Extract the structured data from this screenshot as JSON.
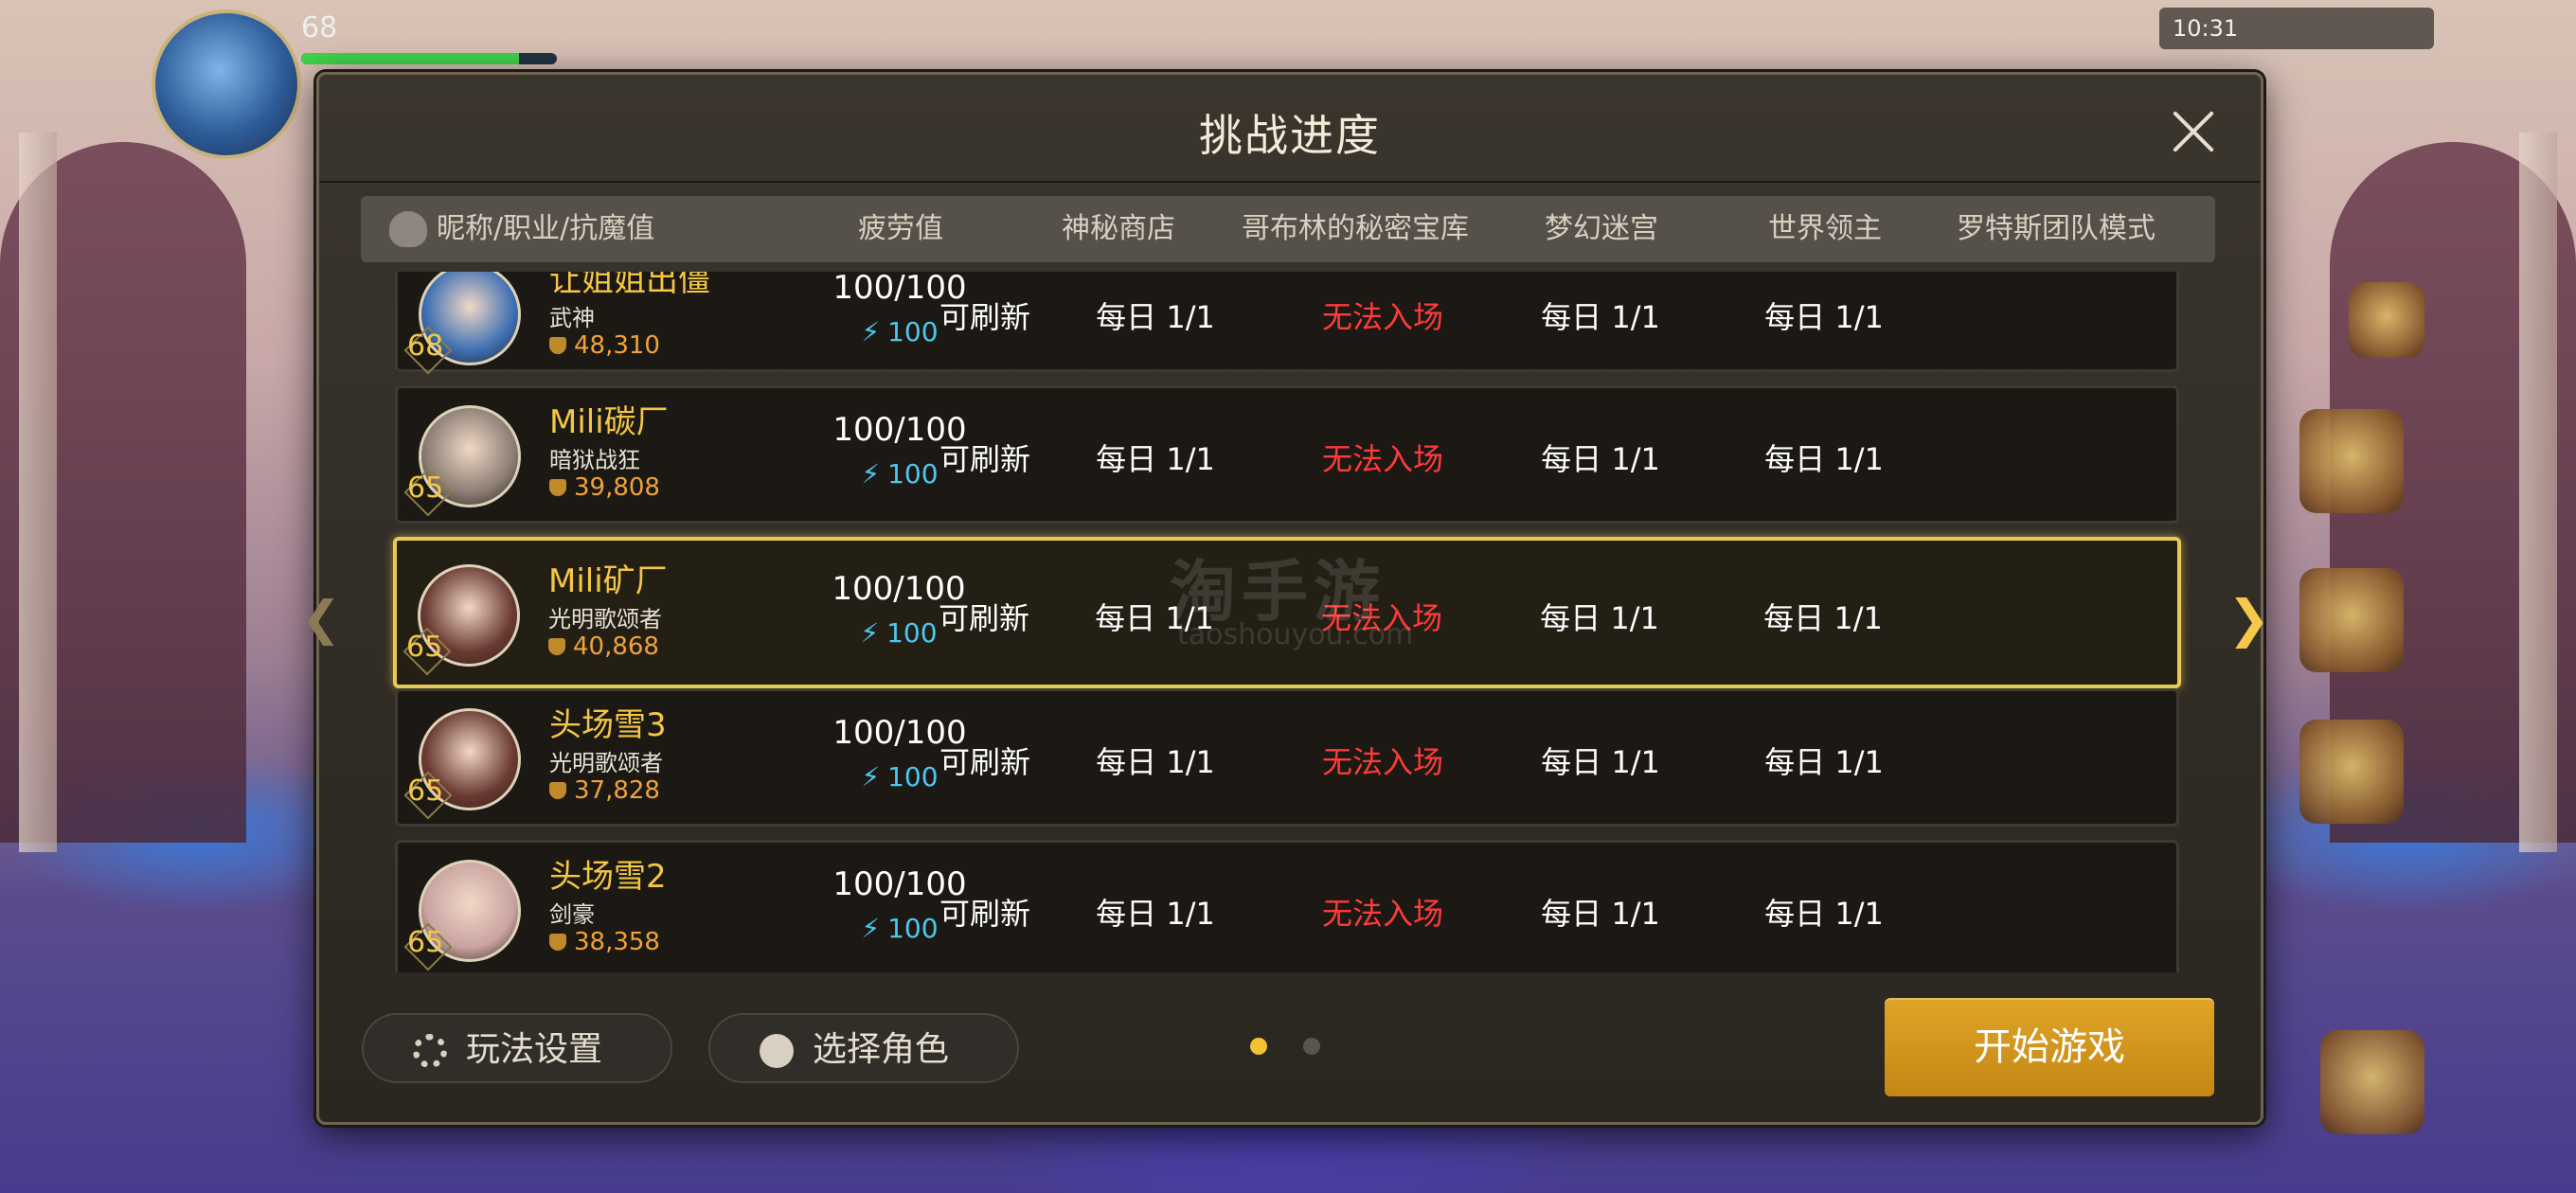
{
  "hud": {
    "level": "68",
    "exp_fraction": 0.85,
    "status_text": "10:31"
  },
  "dialog": {
    "title": "挑战进度",
    "columns": [
      "昵称/职业/抗魔值",
      "疲劳值",
      "神秘商店",
      "哥布林的秘密宝库",
      "梦幻迷宫",
      "世界领主",
      "罗特斯团队模式"
    ]
  },
  "rows": [
    {
      "name": "让姐姐出僵",
      "class": "武神",
      "level": "68",
      "score": "48,310",
      "fatigue": "100/100",
      "energy": "100",
      "shop": "可刷新",
      "goblin": "每日 1/1",
      "maze": "无法入场",
      "lord": "每日 1/1",
      "raid": "每日 1/1",
      "selected": false,
      "avatar_color": "#3d6fb3"
    },
    {
      "name": "Mili碳厂",
      "class": "暗狱战狂",
      "level": "65",
      "score": "39,808",
      "fatigue": "100/100",
      "energy": "100",
      "shop": "可刷新",
      "goblin": "每日 1/1",
      "maze": "无法入场",
      "lord": "每日 1/1",
      "raid": "每日 1/1",
      "selected": false,
      "avatar_color": "#8a7d72"
    },
    {
      "name": "Mili矿厂",
      "class": "光明歌颂者",
      "level": "65",
      "score": "40,868",
      "fatigue": "100/100",
      "energy": "100",
      "shop": "可刷新",
      "goblin": "每日 1/1",
      "maze": "无法入场",
      "lord": "每日 1/1",
      "raid": "每日 1/1",
      "selected": true,
      "avatar_color": "#6a3a32"
    },
    {
      "name": "头场雪3",
      "class": "光明歌颂者",
      "level": "65",
      "score": "37,828",
      "fatigue": "100/100",
      "energy": "100",
      "shop": "可刷新",
      "goblin": "每日 1/1",
      "maze": "无法入场",
      "lord": "每日 1/1",
      "raid": "每日 1/1",
      "selected": false,
      "avatar_color": "#6a3a32"
    },
    {
      "name": "头场雪2",
      "class": "剑豪",
      "level": "65",
      "score": "38,358",
      "fatigue": "100/100",
      "energy": "100",
      "shop": "可刷新",
      "goblin": "每日 1/1",
      "maze": "无法入场",
      "lord": "每日 1/1",
      "raid": "每日 1/1",
      "selected": false,
      "avatar_color": "#c9a3a0"
    }
  ],
  "footer": {
    "settings_label": "玩法设置",
    "role_label": "选择角色",
    "start_label": "开始游戏",
    "page_count": 2,
    "current_page": 1
  },
  "watermark": {
    "main": "淘手游",
    "sub": "taoshouyou.com"
  },
  "colors": {
    "accent_gold": "#e9c955",
    "unavailable_red": "#ff3b3b",
    "energy_blue": "#4cc8f0",
    "start_button": "#d29a1f"
  },
  "icons": {
    "close": "close-icon",
    "settings": "gear-icon",
    "role": "person-icon",
    "energy": "lightning-icon",
    "score": "crest-icon",
    "next": "chevron-right-icon",
    "prev": "chevron-left-icon"
  }
}
